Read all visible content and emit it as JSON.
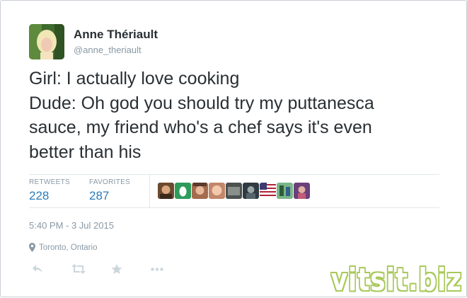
{
  "author": {
    "name": "Anne Thériault",
    "handle": "@anne_theriault"
  },
  "tweet": {
    "lines": [
      "Girl: I actually love cooking",
      "Dude: Oh god you should try my puttanesca",
      "sauce, my friend who's a chef says it's even",
      "better than his"
    ]
  },
  "stats": {
    "retweets_label": "RETWEETS",
    "retweets_count": "228",
    "favorites_label": "FAVORITES",
    "favorites_count": "287"
  },
  "favoriters": [
    {
      "icon": "avatar-photo"
    },
    {
      "icon": "default-egg-avatar"
    },
    {
      "icon": "avatar-photo"
    },
    {
      "icon": "avatar-photo"
    },
    {
      "icon": "avatar-photo"
    },
    {
      "icon": "avatar-photo"
    },
    {
      "icon": "avatar-flag"
    },
    {
      "icon": "avatar-photo"
    },
    {
      "icon": "avatar-photo"
    }
  ],
  "timestamp": "5:40 PM - 3 Jul 2015",
  "location": "Toronto, Ontario",
  "actions": [
    "reply-icon",
    "retweet-icon",
    "favorite-icon",
    "more-icon"
  ],
  "watermark": "vitsit.biz",
  "colors": {
    "link_blue": "#2b7bb9",
    "meta_gray": "#8899a6",
    "text": "#292f33",
    "watermark_green": "#a9c95a"
  }
}
